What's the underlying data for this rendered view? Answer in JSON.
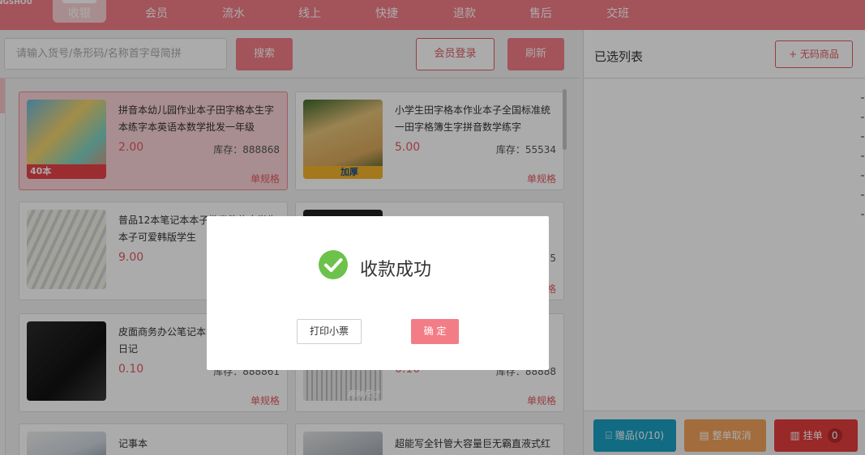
{
  "brand": "NGSHOU",
  "nav": [
    {
      "label": "收银",
      "active": true
    },
    {
      "label": "会员",
      "active": false
    },
    {
      "label": "流水",
      "active": false
    },
    {
      "label": "线上",
      "active": false
    },
    {
      "label": "快捷",
      "active": false
    },
    {
      "label": "退款",
      "active": false
    },
    {
      "label": "售后",
      "active": false
    },
    {
      "label": "交班",
      "active": false
    }
  ],
  "search": {
    "placeholder": "请输入货号/条形码/名称首字母简拼",
    "button": "搜索"
  },
  "toolbar": {
    "member_login": "会员登录",
    "refresh": "刷新"
  },
  "products": [
    {
      "name": "拼音本幼儿园作业本子田字格本生字本练字本英语本数学批发一年级",
      "price": "2.00",
      "stock": "库存：888868",
      "spec": "单规格",
      "selected": true,
      "thumb_text": "40本"
    },
    {
      "name": "小学生田字格本作业本子全国标准统一田字格簿生字拼音数学练字",
      "price": "5.00",
      "stock": "库存：55534",
      "spec": "单规格",
      "selected": false,
      "thumb_text": "加厚"
    },
    {
      "name": "普品12本笔记本本子批发简约大学生本子可爱韩版学生",
      "price": "9.00",
      "stock": "",
      "spec": "",
      "selected": false,
      "thumb_text": ""
    },
    {
      "name": "",
      "price": "",
      "stock": "5",
      "spec": "格",
      "selected": false,
      "thumb_text": ""
    },
    {
      "name": "皮面商务办公笔记本录本子学生作业日记",
      "price": "0.10",
      "stock": "库存：888861",
      "spec": "单规格",
      "selected": false,
      "thumb_text": ""
    },
    {
      "name": "",
      "price": "0.10",
      "stock": "库存：88888",
      "spec": "单规格",
      "selected": false,
      "thumb_text": "两种尺寸"
    },
    {
      "name": "记事本",
      "price": "",
      "stock": "",
      "spec": "",
      "selected": false,
      "thumb_text": ""
    },
    {
      "name": "超能写全针管大容量巨无霸直液式红蓝黑色签字笔",
      "price": "",
      "stock": "",
      "spec": "",
      "selected": false,
      "thumb_text": ""
    }
  ],
  "cart": {
    "title": "已选列表",
    "no_code_button": "+ 无码商品"
  },
  "footer": {
    "gift": "赠品(0/10)",
    "cancel_order": "整单取消",
    "hold": "挂单",
    "hold_count": "0"
  },
  "modal": {
    "title": "收款成功",
    "print_button": "打印小票",
    "ok_button": "确 定"
  },
  "colors": {
    "primary": "#f37d86",
    "accent": "#e35a63",
    "success": "#6cc24a",
    "gift": "#1aa0c4",
    "cancel": "#f4a15a",
    "hold": "#e53d3d"
  }
}
